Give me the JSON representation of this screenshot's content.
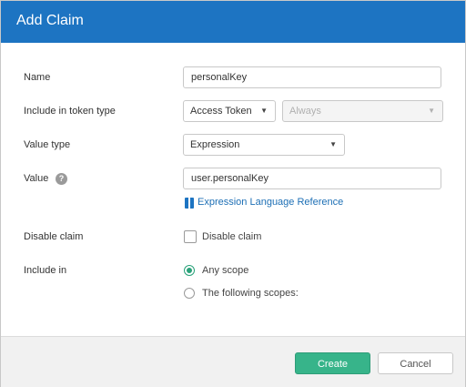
{
  "dialog": {
    "title": "Add Claim",
    "brand_color": "#1d74c2",
    "accent_color": "#37b48a"
  },
  "form": {
    "name": {
      "label": "Name",
      "value": "personalKey"
    },
    "token_type": {
      "label": "Include in token type",
      "selected": "Access Token",
      "secondary_selected": "Always",
      "secondary_disabled": true,
      "caret_icon": "chevron-down-icon"
    },
    "value_type": {
      "label": "Value type",
      "selected": "Expression",
      "caret_icon": "chevron-down-icon"
    },
    "value": {
      "label": "Value",
      "help_glyph": "?",
      "value": "user.personalKey",
      "link_text": "Expression Language Reference",
      "link_icon": "book-icon"
    },
    "disable_claim": {
      "label": "Disable claim",
      "checkbox_label": "Disable claim",
      "checked": false
    },
    "include_in": {
      "label": "Include in",
      "options": [
        {
          "label": "Any scope",
          "checked": true
        },
        {
          "label": "The following scopes:",
          "checked": false
        }
      ]
    }
  },
  "footer": {
    "create_label": "Create",
    "cancel_label": "Cancel"
  }
}
